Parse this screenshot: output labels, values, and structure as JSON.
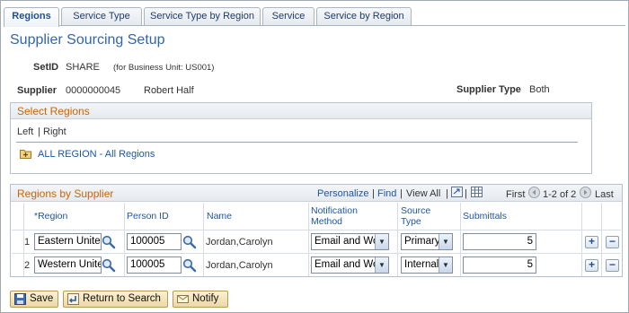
{
  "tabs": [
    "Regions",
    "Service Type",
    "Service Type by Region",
    "Service",
    "Service by Region"
  ],
  "page_title": "Supplier Sourcing Setup",
  "setid": {
    "label": "SetID",
    "value": "SHARE",
    "note": "(for Business Unit: US001)"
  },
  "supplier": {
    "label": "Supplier",
    "id": "0000000045",
    "name": "Robert Half",
    "type_label": "Supplier Type",
    "type_value": "Both"
  },
  "select_regions": {
    "title": "Select Regions",
    "left": "Left",
    "sep": "|",
    "right": "Right",
    "tree_item": "ALL REGION - All Regions"
  },
  "grid": {
    "title": "Regions by Supplier",
    "personalize": "Personalize",
    "find": "Find",
    "view_all": "View All",
    "first": "First",
    "range": "1-2 of 2",
    "last": "Last",
    "headers": {
      "region": "*Region",
      "person_id": "Person ID",
      "name": "Name",
      "notif1": "Notification",
      "notif2": "Method",
      "src1": "Source",
      "src2": "Type",
      "submittals": "Submittals"
    },
    "rows": [
      {
        "num": "1",
        "region": "Eastern United",
        "person_id": "100005",
        "name": "Jordan,Carolyn",
        "notification": "Email and Wor",
        "source": "Primary",
        "submittals": "5"
      },
      {
        "num": "2",
        "region": "Western Unitec",
        "person_id": "100005",
        "name": "Jordan,Carolyn",
        "notification": "Email and Wor",
        "source": "Internal",
        "submittals": "5"
      }
    ]
  },
  "buttons": {
    "save": "Save",
    "return": "Return to Search",
    "notify": "Notify"
  }
}
